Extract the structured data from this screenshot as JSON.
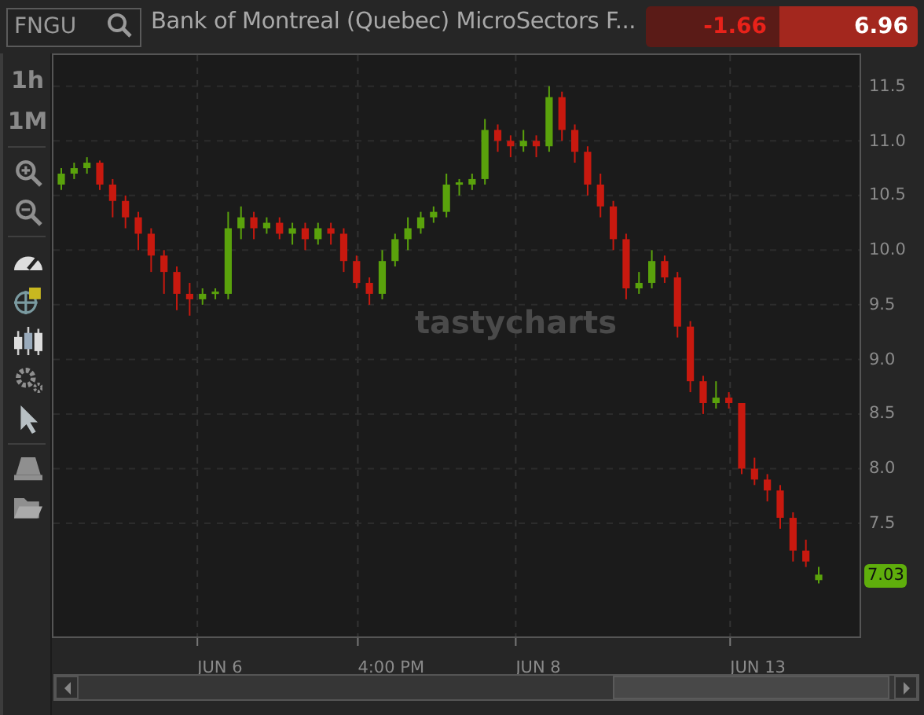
{
  "symbol_field": {
    "value": "FNGU"
  },
  "instrument_name": "Bank of Montreal (Quebec) MicroSectors F...",
  "quote": {
    "change": "-1.66",
    "last": "6.96"
  },
  "timeframes": [
    "1h",
    "1M"
  ],
  "chart": {
    "watermark": "tastycharts",
    "last_price_tag": "7.03",
    "chart_data": {
      "type": "candlestick",
      "grid": true,
      "ylim": [
        6.45,
        11.8
      ],
      "ohlc": [
        [
          10.6,
          10.75,
          10.55,
          10.7
        ],
        [
          10.7,
          10.8,
          10.65,
          10.75
        ],
        [
          10.75,
          10.85,
          10.7,
          10.8
        ],
        [
          10.8,
          10.82,
          10.55,
          10.6
        ],
        [
          10.6,
          10.65,
          10.3,
          10.45
        ],
        [
          10.45,
          10.5,
          10.2,
          10.3
        ],
        [
          10.3,
          10.35,
          10.0,
          10.15
        ],
        [
          10.15,
          10.2,
          9.8,
          9.95
        ],
        [
          9.95,
          10.0,
          9.6,
          9.8
        ],
        [
          9.8,
          9.85,
          9.45,
          9.6
        ],
        [
          9.6,
          9.7,
          9.4,
          9.55
        ],
        [
          9.55,
          9.65,
          9.5,
          9.6
        ],
        [
          9.6,
          9.65,
          9.55,
          9.62
        ],
        [
          9.6,
          10.35,
          9.55,
          10.2
        ],
        [
          10.2,
          10.4,
          10.1,
          10.3
        ],
        [
          10.3,
          10.35,
          10.1,
          10.2
        ],
        [
          10.2,
          10.3,
          10.15,
          10.25
        ],
        [
          10.25,
          10.3,
          10.1,
          10.15
        ],
        [
          10.15,
          10.25,
          10.05,
          10.2
        ],
        [
          10.2,
          10.25,
          10.0,
          10.1
        ],
        [
          10.1,
          10.25,
          10.05,
          10.2
        ],
        [
          10.2,
          10.25,
          10.05,
          10.15
        ],
        [
          10.15,
          10.2,
          9.8,
          9.9
        ],
        [
          9.9,
          9.95,
          9.65,
          9.7
        ],
        [
          9.7,
          9.75,
          9.5,
          9.6
        ],
        [
          9.6,
          10.0,
          9.55,
          9.9
        ],
        [
          9.9,
          10.15,
          9.85,
          10.1
        ],
        [
          10.1,
          10.3,
          10.0,
          10.2
        ],
        [
          10.2,
          10.35,
          10.15,
          10.3
        ],
        [
          10.3,
          10.4,
          10.25,
          10.35
        ],
        [
          10.35,
          10.7,
          10.3,
          10.6
        ],
        [
          10.6,
          10.65,
          10.5,
          10.62
        ],
        [
          10.6,
          10.7,
          10.55,
          10.65
        ],
        [
          10.65,
          11.2,
          10.6,
          11.1
        ],
        [
          11.1,
          11.15,
          10.9,
          11.0
        ],
        [
          11.0,
          11.05,
          10.85,
          10.95
        ],
        [
          10.95,
          11.1,
          10.9,
          11.0
        ],
        [
          11.0,
          11.05,
          10.85,
          10.95
        ],
        [
          10.95,
          11.5,
          10.9,
          11.4
        ],
        [
          11.4,
          11.45,
          11.0,
          11.1
        ],
        [
          11.1,
          11.15,
          10.8,
          10.9
        ],
        [
          10.9,
          10.95,
          10.5,
          10.6
        ],
        [
          10.6,
          10.7,
          10.3,
          10.4
        ],
        [
          10.4,
          10.45,
          10.0,
          10.1
        ],
        [
          10.1,
          10.15,
          9.55,
          9.65
        ],
        [
          9.65,
          9.8,
          9.6,
          9.7
        ],
        [
          9.7,
          10.0,
          9.65,
          9.9
        ],
        [
          9.9,
          9.95,
          9.7,
          9.75
        ],
        [
          9.75,
          9.8,
          9.2,
          9.3
        ],
        [
          9.3,
          9.35,
          8.7,
          8.8
        ],
        [
          8.8,
          8.85,
          8.5,
          8.6
        ],
        [
          8.6,
          8.8,
          8.55,
          8.65
        ],
        [
          8.65,
          8.7,
          8.55,
          8.6
        ],
        [
          8.6,
          8.6,
          7.95,
          8.0
        ],
        [
          8.0,
          8.1,
          7.85,
          7.9
        ],
        [
          7.9,
          7.95,
          7.7,
          7.8
        ],
        [
          7.8,
          7.85,
          7.45,
          7.55
        ],
        [
          7.55,
          7.6,
          7.15,
          7.25
        ],
        [
          7.25,
          7.35,
          7.1,
          7.15
        ],
        [
          6.98,
          7.1,
          6.95,
          7.03
        ]
      ],
      "yticks": [
        {
          "value": 11.5,
          "label": "11.5"
        },
        {
          "value": 11.0,
          "label": "11.0"
        },
        {
          "value": 10.5,
          "label": "10.5"
        },
        {
          "value": 10.0,
          "label": "10.0"
        },
        {
          "value": 9.5,
          "label": "9.5"
        },
        {
          "value": 9.0,
          "label": "9.0"
        },
        {
          "value": 8.5,
          "label": "8.5"
        },
        {
          "value": 8.0,
          "label": "8.0"
        },
        {
          "value": 7.5,
          "label": "7.5"
        }
      ]
    },
    "x_axis_labels": [
      "JUN 6",
      "4:00 PM",
      "JUN 8",
      "JUN 13"
    ]
  }
}
